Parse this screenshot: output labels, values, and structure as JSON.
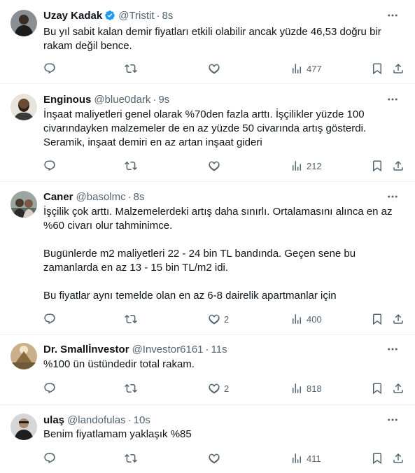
{
  "tweets": [
    {
      "name": "Uzay Kadak",
      "verified": true,
      "handle": "@Tristit",
      "sep": "·",
      "time": "8s",
      "paragraphs": [
        "Bu yıl sabit kalan demir fiyatları etkili olabilir ancak yüzde 46,53 doğru bir rakam değil bence."
      ],
      "likes": "",
      "views": "477"
    },
    {
      "name": "Enginous",
      "verified": false,
      "handle": "@blue0dark",
      "sep": "·",
      "time": "9s",
      "paragraphs": [
        "İnşaat maliyetleri genel olarak %70den fazla arttı. İşçilikler yüzde 100 civarındayken malzemeler de en az yüzde 50 civarında artış gösterdi. Seramik, inşaat demiri en az artan inşaat gideri"
      ],
      "likes": "",
      "views": "212"
    },
    {
      "name": "Caner",
      "verified": false,
      "handle": "@basolmc",
      "sep": "·",
      "time": "8s",
      "paragraphs": [
        "İşçilik çok arttı. Malzemelerdeki artış daha sınırlı. Ortalamasını alınca en az %60 civarı olur tahminimce.",
        "Bugünlerde m2 maliyetleri 22 - 24 bin TL bandında. Geçen sene bu zamanlarda en az 13 - 15 bin TL/m2 idi.",
        "Bu fiyatlar aynı temelde olan en az 6-8 dairelik apartmanlar için"
      ],
      "likes": "2",
      "views": "400"
    },
    {
      "name": "Dr. Smallİnvestor",
      "verified": false,
      "handle": "@Investor6161",
      "sep": "·",
      "time": "11s",
      "paragraphs": [
        "%100 ün üstündedir total rakam."
      ],
      "likes": "2",
      "views": "818"
    },
    {
      "name": "ulaş",
      "verified": false,
      "handle": "@landofulas",
      "sep": "·",
      "time": "10s",
      "paragraphs": [
        "Benim fiyatlamam yaklaşık %85"
      ],
      "likes": "",
      "views": "411"
    }
  ],
  "icons": {
    "more": "more-horizontal-icon",
    "reply": "reply-icon",
    "retweet": "retweet-icon",
    "like": "heart-icon",
    "views": "views-chart-icon",
    "bookmark": "bookmark-icon",
    "share": "share-icon",
    "verified": "verified-badge-icon"
  },
  "colors": {
    "text": "#0f1419",
    "secondary": "#536471",
    "verified": "#1d9bf0",
    "divider": "#eff3f4"
  }
}
